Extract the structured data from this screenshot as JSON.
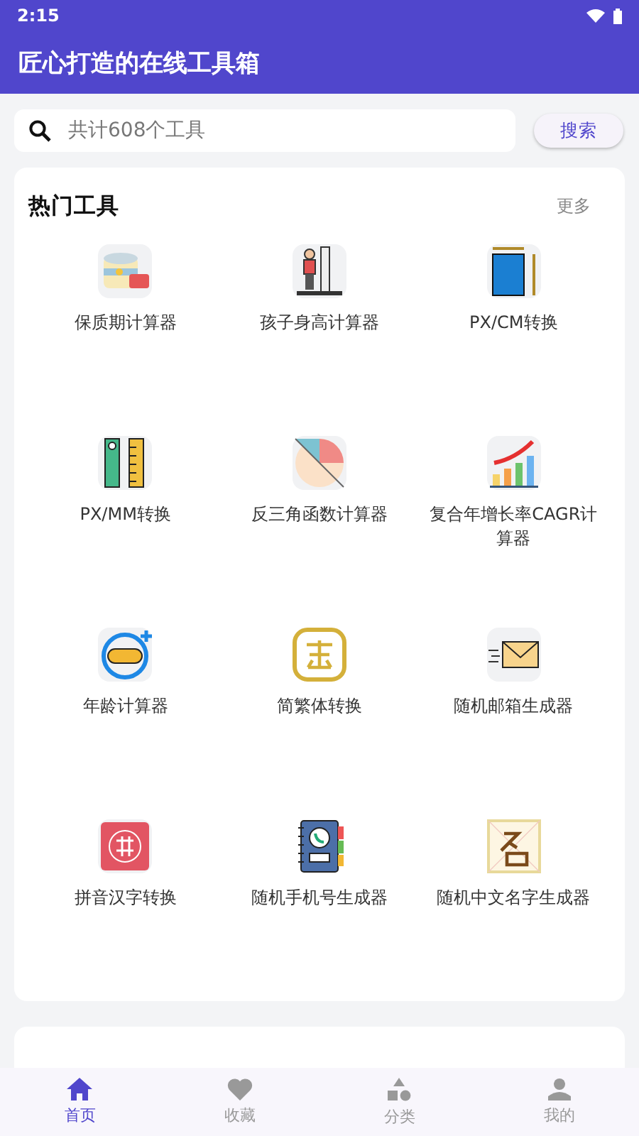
{
  "status_bar": {
    "time": "2:15"
  },
  "app_bar": {
    "title": "匠心打造的在线工具箱"
  },
  "search": {
    "placeholder": "共计608个工具",
    "button": "搜索"
  },
  "hot_tools": {
    "title": "热门工具",
    "more": "更多",
    "tools": [
      {
        "label": "保质期计算器"
      },
      {
        "label": "孩子身高计算器"
      },
      {
        "label": "PX/CM转换"
      },
      {
        "label": "PX/MM转换"
      },
      {
        "label": "反三角函数计算器"
      },
      {
        "label": "复合年增长率CAGR计算器"
      },
      {
        "label": "年龄计算器"
      },
      {
        "label": "简繁体转换"
      },
      {
        "label": "随机邮箱生成器"
      },
      {
        "label": "拼音汉字转换"
      },
      {
        "label": "随机手机号生成器"
      },
      {
        "label": "随机中文名字生成器"
      }
    ]
  },
  "bottom_nav": [
    {
      "label": "首页",
      "selected": true
    },
    {
      "label": "收藏",
      "selected": false
    },
    {
      "label": "分类",
      "selected": false
    },
    {
      "label": "我的",
      "selected": false
    }
  ]
}
